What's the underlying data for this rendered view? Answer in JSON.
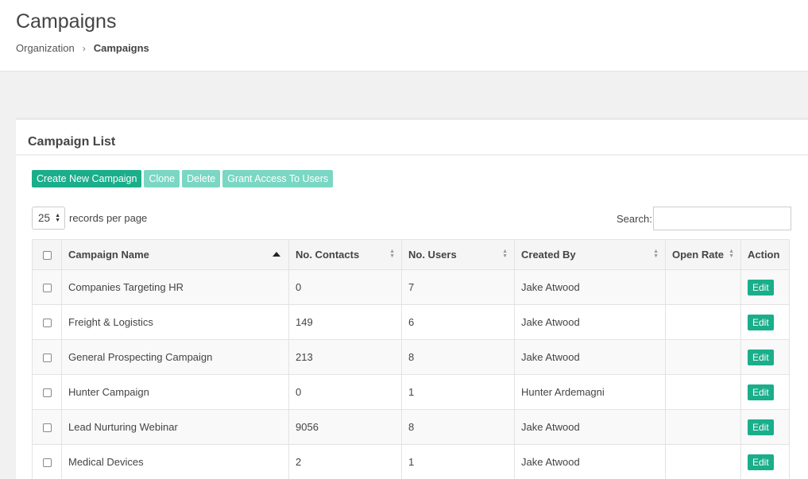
{
  "header": {
    "title": "Campaigns",
    "breadcrumb": [
      "Organization",
      "Campaigns"
    ],
    "breadcrumb_separator": "›"
  },
  "panel": {
    "title": "Campaign List"
  },
  "toolbar": {
    "create_label": "Create New Campaign",
    "clone_label": "Clone",
    "delete_label": "Delete",
    "grant_label": "Grant Access To Users"
  },
  "length": {
    "value": "25",
    "label": "records per page"
  },
  "search": {
    "label": "Search:",
    "value": "",
    "placeholder": ""
  },
  "table": {
    "columns": [
      "Campaign Name",
      "No. Contacts",
      "No. Users",
      "Created By",
      "Open Rate",
      "Action"
    ],
    "sort_column": "Campaign Name",
    "sort_direction": "ascending",
    "edit_label": "Edit",
    "rows": [
      {
        "name": "Companies Targeting HR",
        "contacts": "0",
        "users": "7",
        "created_by": "Jake Atwood",
        "open_rate": ""
      },
      {
        "name": "Freight & Logistics",
        "contacts": "149",
        "users": "6",
        "created_by": "Jake Atwood",
        "open_rate": ""
      },
      {
        "name": "General Prospecting Campaign",
        "contacts": "213",
        "users": "8",
        "created_by": "Jake Atwood",
        "open_rate": ""
      },
      {
        "name": "Hunter Campaign",
        "contacts": "0",
        "users": "1",
        "created_by": "Hunter Ardemagni",
        "open_rate": ""
      },
      {
        "name": "Lead Nurturing Webinar",
        "contacts": "9056",
        "users": "8",
        "created_by": "Jake Atwood",
        "open_rate": ""
      },
      {
        "name": "Medical Devices",
        "contacts": "2",
        "users": "1",
        "created_by": "Jake Atwood",
        "open_rate": ""
      }
    ]
  },
  "colors": {
    "primary": "#1aae8a",
    "primary_muted": "#7ad7c3"
  }
}
